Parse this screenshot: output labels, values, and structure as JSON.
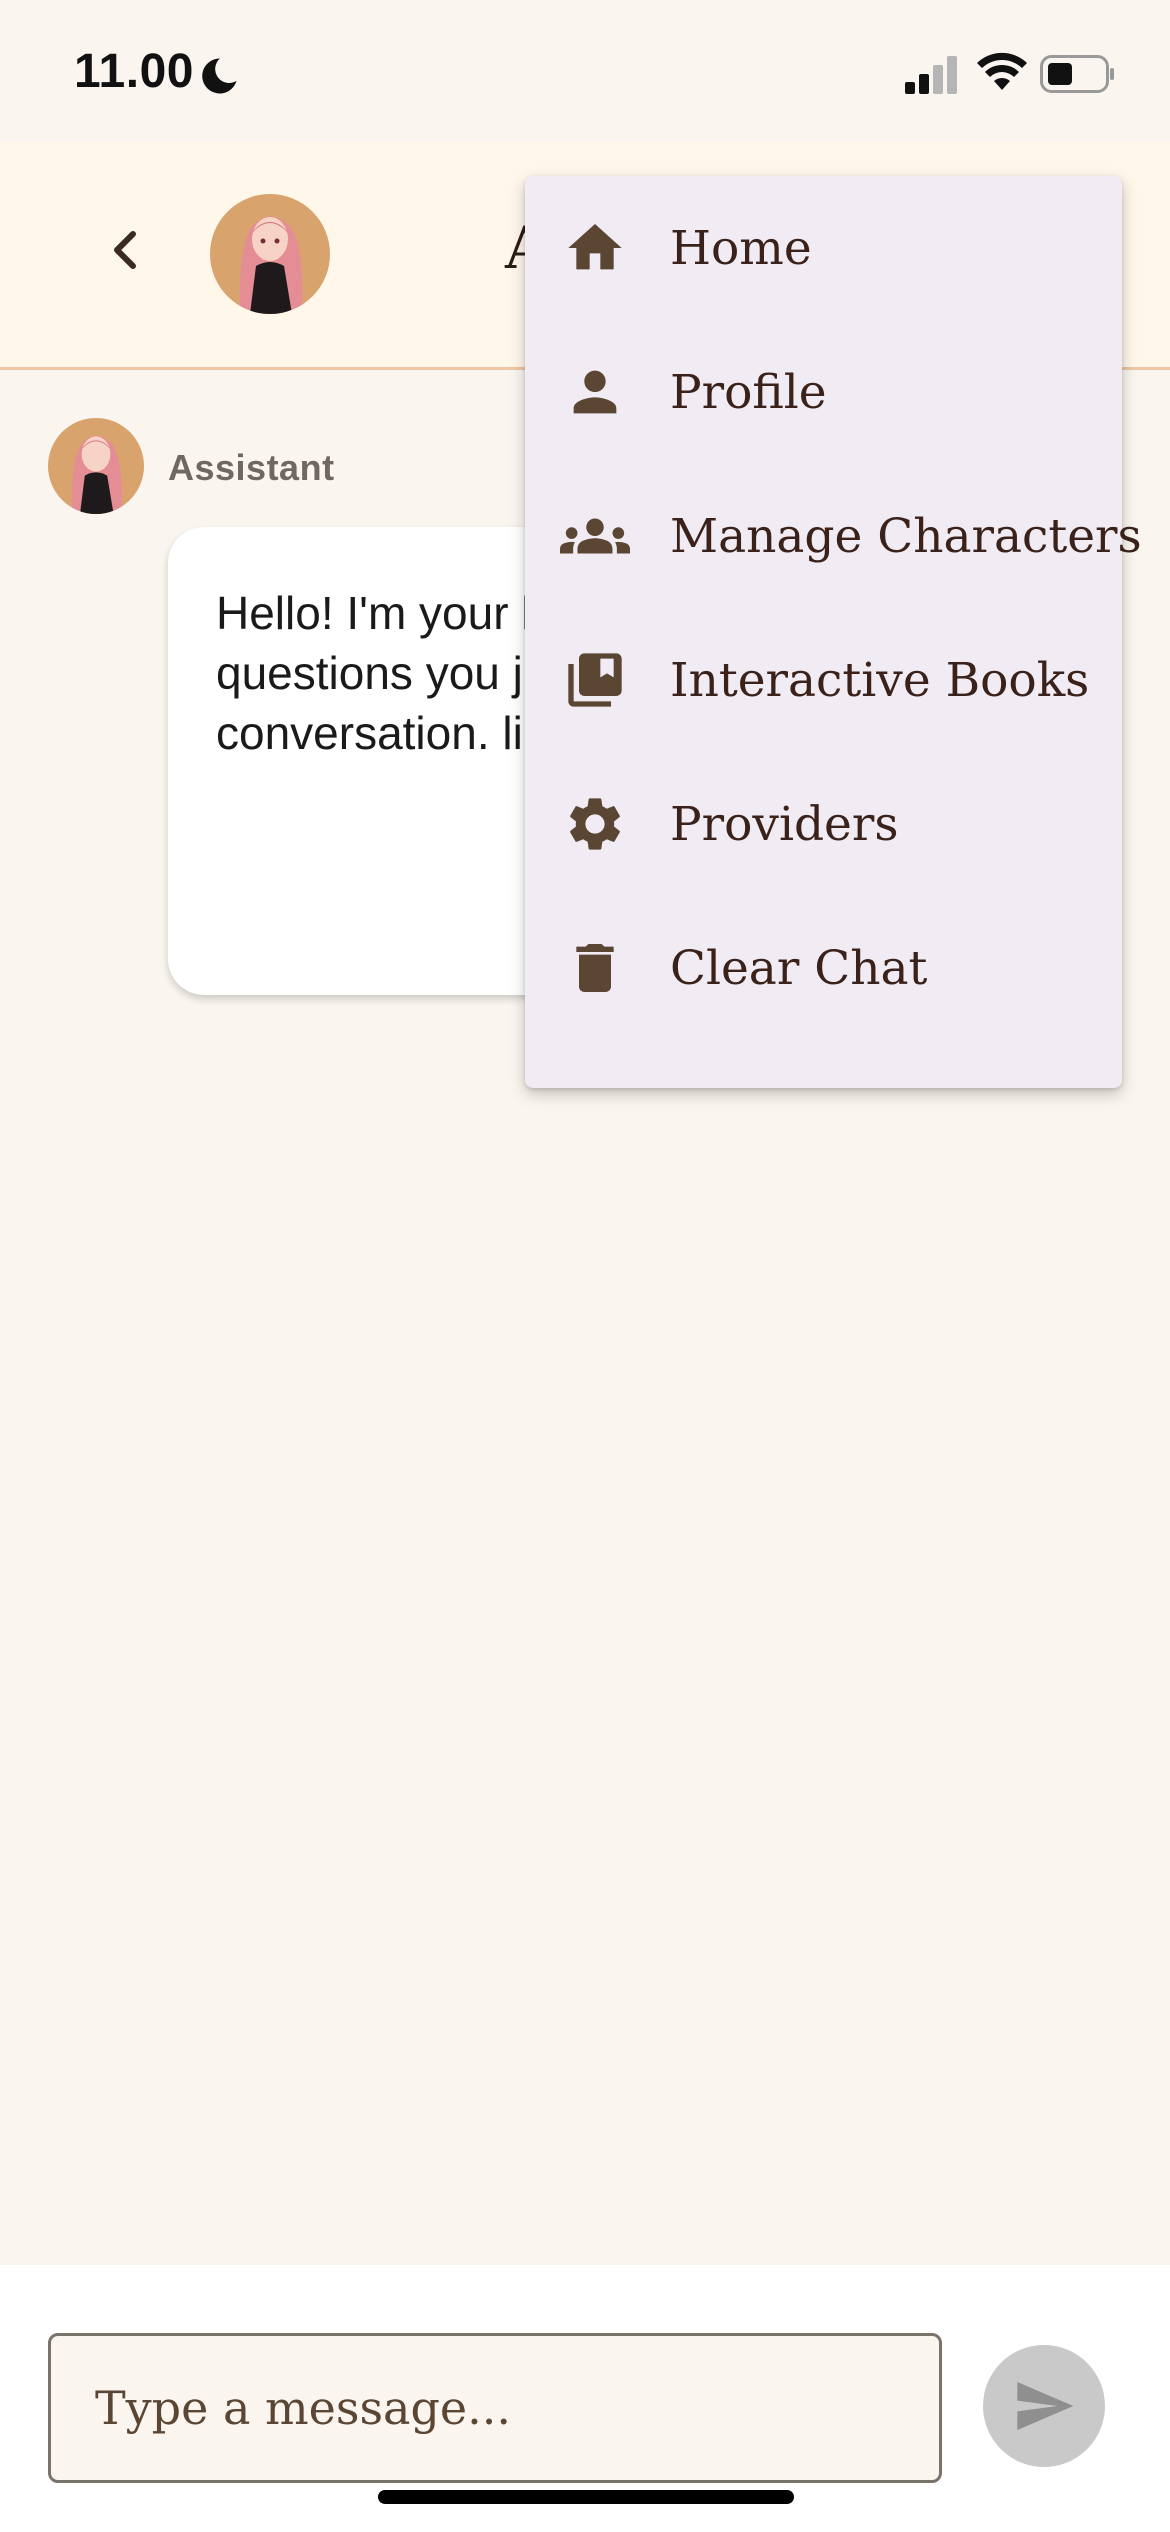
{
  "status_bar": {
    "time": "11.00"
  },
  "header": {
    "title": "A"
  },
  "chat": {
    "messages": [
      {
        "sender": "Assistant",
        "text": "Hello! I'm your here to help w questions you just to have a conversation. like to talk abo"
      }
    ]
  },
  "menu": {
    "items": [
      {
        "label": "Home",
        "icon": "home-icon"
      },
      {
        "label": "Profile",
        "icon": "person-icon"
      },
      {
        "label": "Manage Characters",
        "icon": "group-icon"
      },
      {
        "label": "Interactive Books",
        "icon": "library-books-icon"
      },
      {
        "label": "Providers",
        "icon": "gear-icon"
      },
      {
        "label": "Clear Chat",
        "icon": "trash-icon"
      }
    ]
  },
  "composer": {
    "placeholder": "Type a message..."
  },
  "colors": {
    "background": "#faf6ef",
    "header_bg": "#fff7ea",
    "header_border": "#f0c7a4",
    "menu_bg": "#f1ecf3",
    "icon_brown": "#5b4634",
    "text_dark": "#3a2119",
    "send_disabled": "#c9c9c9"
  }
}
